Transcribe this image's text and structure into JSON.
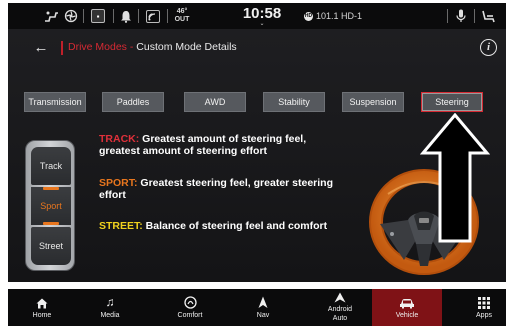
{
  "status_bar": {
    "climate_icon": "steering-heat-fan-icon",
    "outside_temp": {
      "value": "46°",
      "label": "OUT"
    },
    "time": "10:58",
    "radio_station": "101.1 HD-1",
    "radio_badge": "HD"
  },
  "header": {
    "back_icon": "←",
    "breadcrumb_link": "Drive Modes",
    "breadcrumb_separator": " - ",
    "title": "Custom Mode Details",
    "info_icon": "i"
  },
  "tabs": [
    {
      "label": "Transmission",
      "active": false
    },
    {
      "label": "Paddles",
      "active": false
    },
    {
      "label": "AWD",
      "active": false
    },
    {
      "label": "Stability",
      "active": false
    },
    {
      "label": "Suspension",
      "active": false
    },
    {
      "label": "Steering",
      "active": true
    }
  ],
  "mode_selector": {
    "modes": [
      {
        "label": "Track",
        "selected": false
      },
      {
        "label": "Sport",
        "selected": true
      },
      {
        "label": "Street",
        "selected": false
      }
    ]
  },
  "descriptions": [
    {
      "mode": "TRACK:",
      "text": " Greatest amount of steering feel, greatest amount of steering effort",
      "color": "#e0303a"
    },
    {
      "mode": "SPORT:",
      "text": " Greatest steering feel, greater steering effort",
      "color": "#e8761e"
    },
    {
      "mode": "STREET:",
      "text": " Balance of steering feel and comfort",
      "color": "#f0d21e"
    }
  ],
  "nav": [
    {
      "label": "Home",
      "icon": "home-icon"
    },
    {
      "label": "Media",
      "icon": "music-note-icon"
    },
    {
      "label": "Comfort",
      "icon": "comfort-icon"
    },
    {
      "label": "Nav",
      "icon": "navigation-arrow-icon"
    },
    {
      "label": "Android Auto",
      "icon": "android-auto-icon"
    },
    {
      "label": "Vehicle",
      "icon": "car-icon",
      "active": true
    },
    {
      "label": "Apps",
      "icon": "apps-grid-icon"
    }
  ],
  "colors": {
    "accent_red": "#d62a33",
    "sport_orange": "#e8761e",
    "street_yellow": "#f0d21e",
    "vehicle_tab_bg": "#7f1216"
  }
}
